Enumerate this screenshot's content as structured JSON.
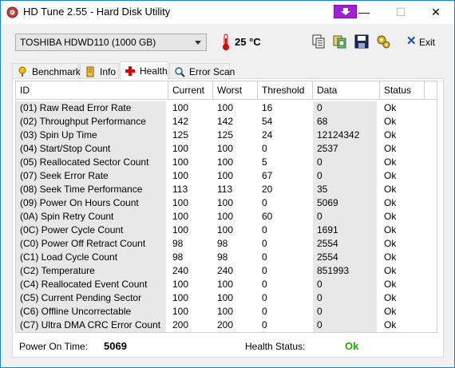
{
  "window": {
    "title": "HD Tune 2.55 - Hard Disk Utility",
    "controls": {
      "minimize": "—",
      "maximize": "☐",
      "close": "✕"
    }
  },
  "toolbar": {
    "drive": "TOSHIBA HDWD110 (1000 GB)",
    "temperature": "25 °C",
    "exit_label": "Exit",
    "icons": [
      "copy-info-icon",
      "copy-screen-icon",
      "save-icon",
      "options-icon"
    ]
  },
  "tabs": [
    {
      "label": "Benchmark",
      "icon": "benchmark-icon",
      "active": false
    },
    {
      "label": "Info",
      "icon": "info-icon",
      "active": false
    },
    {
      "label": "Health",
      "icon": "health-cross-icon",
      "active": true
    },
    {
      "label": "Error Scan",
      "icon": "magnifier-icon",
      "active": false
    }
  ],
  "health_table": {
    "columns": [
      "ID",
      "Current",
      "Worst",
      "Threshold",
      "Data",
      "Status"
    ],
    "rows": [
      [
        "(01) Raw Read Error Rate",
        "100",
        "100",
        "16",
        "0",
        "Ok"
      ],
      [
        "(02) Throughput Performance",
        "142",
        "142",
        "54",
        "68",
        "Ok"
      ],
      [
        "(03) Spin Up Time",
        "125",
        "125",
        "24",
        "12124342",
        "Ok"
      ],
      [
        "(04) Start/Stop Count",
        "100",
        "100",
        "0",
        "2537",
        "Ok"
      ],
      [
        "(05) Reallocated Sector Count",
        "100",
        "100",
        "5",
        "0",
        "Ok"
      ],
      [
        "(07) Seek Error Rate",
        "100",
        "100",
        "67",
        "0",
        "Ok"
      ],
      [
        "(08) Seek Time Performance",
        "113",
        "113",
        "20",
        "35",
        "Ok"
      ],
      [
        "(09) Power On Hours Count",
        "100",
        "100",
        "0",
        "5069",
        "Ok"
      ],
      [
        "(0A) Spin Retry Count",
        "100",
        "100",
        "60",
        "0",
        "Ok"
      ],
      [
        "(0C) Power Cycle Count",
        "100",
        "100",
        "0",
        "1691",
        "Ok"
      ],
      [
        "(C0) Power Off Retract Count",
        "98",
        "98",
        "0",
        "2554",
        "Ok"
      ],
      [
        "(C1) Load Cycle Count",
        "98",
        "98",
        "0",
        "2554",
        "Ok"
      ],
      [
        "(C2) Temperature",
        "240",
        "240",
        "0",
        "851993",
        "Ok"
      ],
      [
        "(C4) Reallocated Event Count",
        "100",
        "100",
        "0",
        "0",
        "Ok"
      ],
      [
        "(C5) Current Pending Sector",
        "100",
        "100",
        "0",
        "0",
        "Ok"
      ],
      [
        "(C6) Offline Uncorrectable",
        "100",
        "100",
        "0",
        "0",
        "Ok"
      ],
      [
        "(C7) Ultra DMA CRC Error Count",
        "200",
        "200",
        "0",
        "0",
        "Ok"
      ]
    ]
  },
  "footer": {
    "power_on_label": "Power On Time:",
    "power_on_value": "5069",
    "health_label": "Health Status:",
    "health_value": "Ok"
  },
  "colors": {
    "health_ok": "#22b000",
    "titlebar_border": "#1883d7",
    "purple_button": "#a020d6"
  }
}
